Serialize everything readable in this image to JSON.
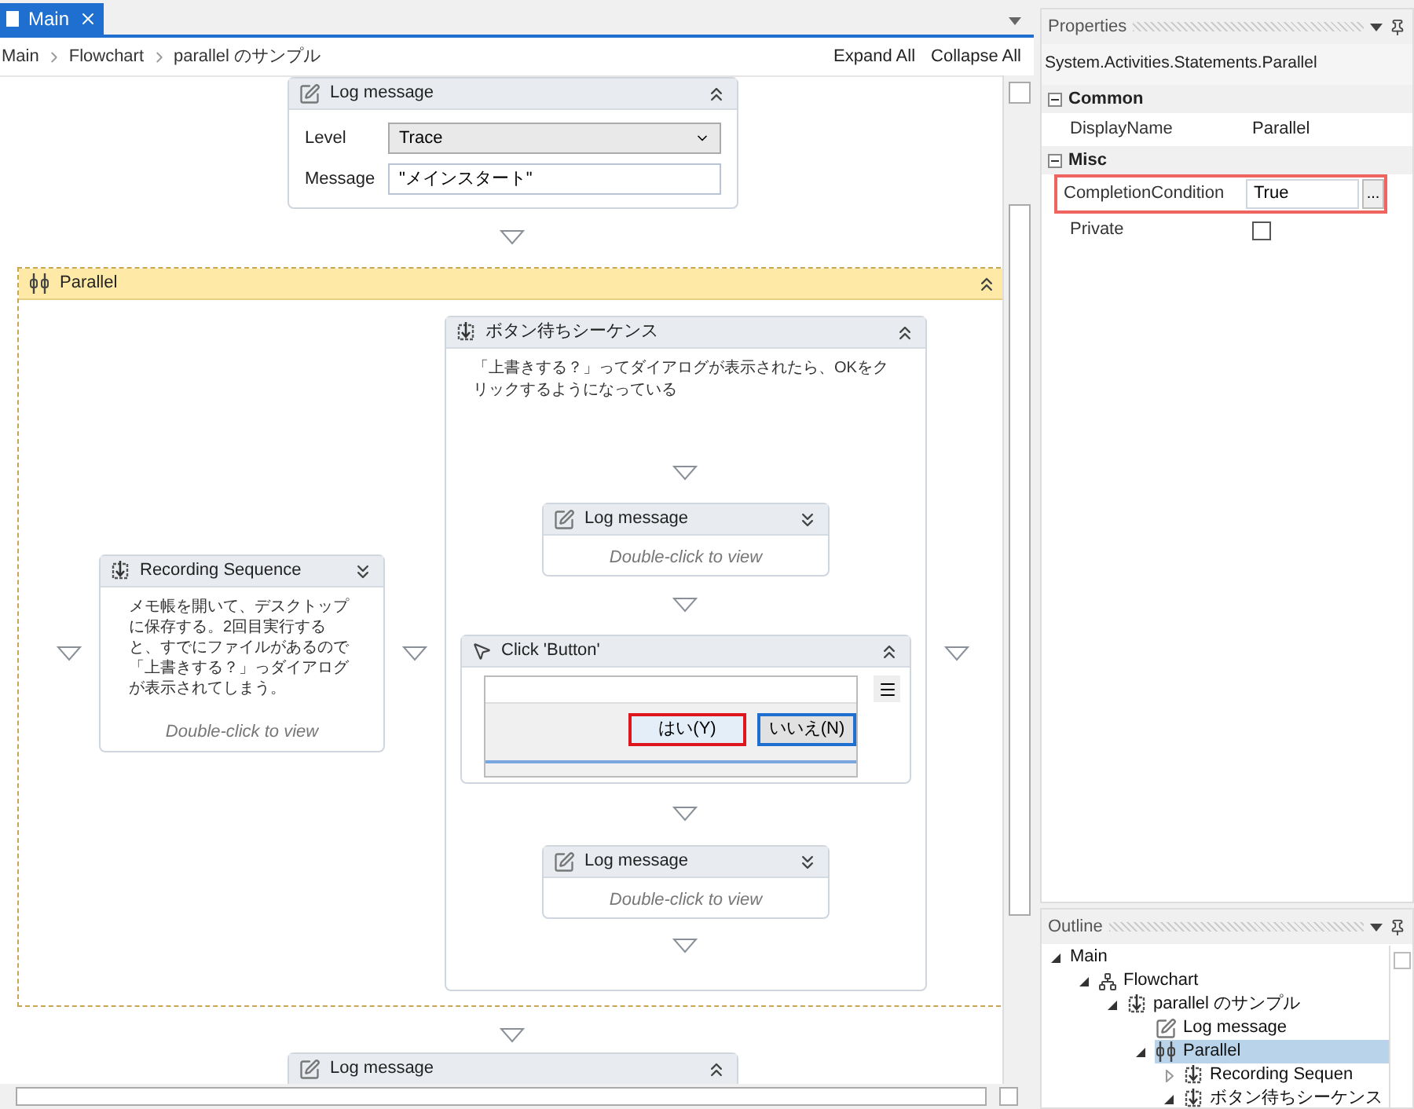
{
  "tab": {
    "label": "Main",
    "selected": true
  },
  "breadcrumb": [
    "Main",
    "Flowchart",
    "parallel のサンプル"
  ],
  "toolbar": [
    "Expand All",
    "Collapse All"
  ],
  "log_top": {
    "title": "Log message",
    "expanded": true,
    "fields": [
      {
        "label": "Level",
        "value": "Trace",
        "kind": "select"
      },
      {
        "label": "Message",
        "value": "\"メインスタート\"",
        "kind": "text"
      }
    ]
  },
  "parallel": {
    "title": "Parallel",
    "expanded": true,
    "recording": {
      "title": "Recording Sequence",
      "expanded": false,
      "note": "メモ帳を開いて、デスクトップに保存する。2回目実行すると、すでにファイルがあるので「上書きする？」っダイアログが表示されてしまう。",
      "hint": "Double-click to view"
    },
    "sequence": {
      "title": "ボタン待ちシーケンス",
      "expanded": true,
      "note": "「上書きする？」ってダイアログが表示されたら、OKをクリックするようになっている",
      "log1": {
        "title": "Log message",
        "expanded": false,
        "hint": "Double-click to view"
      },
      "click": {
        "title": "Click 'Button'",
        "expanded": true,
        "buttons": [
          {
            "label": "はい(Y)",
            "selected": true
          },
          {
            "label": "いいえ(N)",
            "selected": false
          }
        ]
      },
      "log2": {
        "title": "Log message",
        "expanded": false,
        "hint": "Double-click to view"
      }
    }
  },
  "log_bottom": {
    "title": "Log message",
    "expanded": true
  },
  "properties": {
    "title": "Properties",
    "type_name": "System.Activities.Statements.Parallel",
    "categories": [
      {
        "name": "Common",
        "expanded": true,
        "rows": [
          {
            "name": "DisplayName",
            "kind": "text",
            "value": "Parallel",
            "highlighted": false
          }
        ]
      },
      {
        "name": "Misc",
        "expanded": true,
        "rows": [
          {
            "name": "CompletionCondition",
            "kind": "expression",
            "value": "True",
            "button": "...",
            "highlighted": true
          },
          {
            "name": "Private",
            "kind": "checkbox",
            "checked": false,
            "highlighted": false
          }
        ]
      }
    ]
  },
  "outline": {
    "title": "Outline",
    "tree": [
      {
        "label": "Main",
        "expanded": true,
        "selected": false,
        "children": [
          {
            "label": "Flowchart",
            "kind": "flowchart",
            "expanded": true,
            "selected": false,
            "children": [
              {
                "label": "parallel のサンプル",
                "kind": "sequence",
                "expanded": true,
                "selected": false,
                "children": [
                  {
                    "label": "Log message",
                    "kind": "log",
                    "selected": false
                  },
                  {
                    "label": "Parallel",
                    "kind": "parallel",
                    "expanded": true,
                    "selected": true,
                    "children": [
                      {
                        "label": "Recording Sequen",
                        "kind": "sequence",
                        "expanded": false,
                        "selected": false
                      },
                      {
                        "label": "ボタン待ちシーケンス",
                        "kind": "sequence",
                        "expanded": true,
                        "selected": false
                      }
                    ]
                  }
                ]
              }
            ]
          }
        ]
      }
    ]
  }
}
